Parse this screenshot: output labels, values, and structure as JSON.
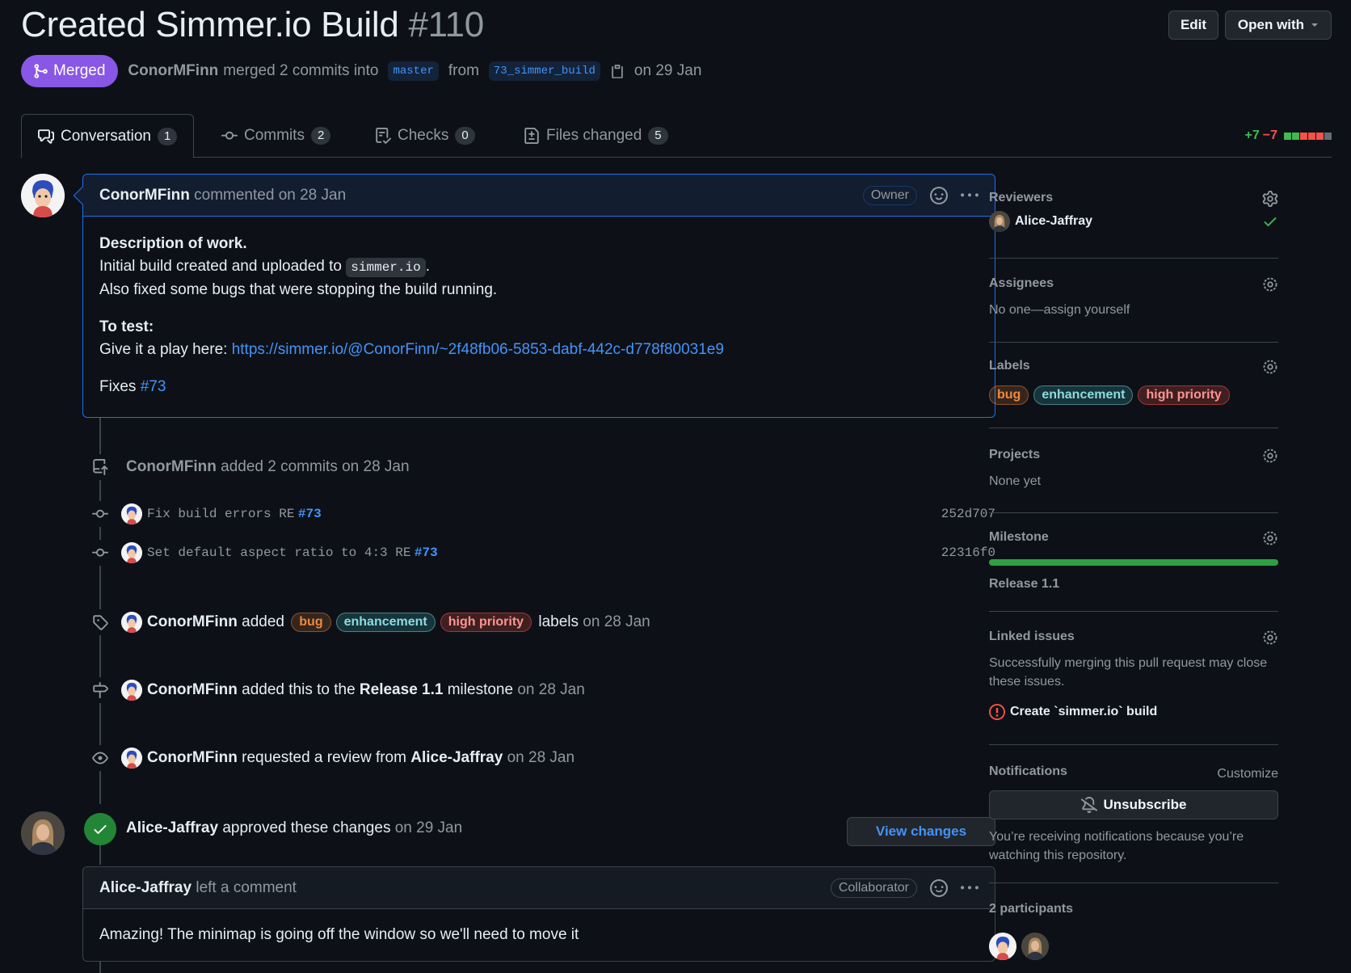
{
  "pr": {
    "title": "Created Simmer.io Build",
    "number": "#110"
  },
  "header": {
    "edit_label": "Edit",
    "open_with_label": "Open with"
  },
  "meta": {
    "status": "Merged",
    "author": "ConorMFinn",
    "action": "merged 2 commits into",
    "base_branch": "master",
    "from": "from",
    "head_branch": "73_simmer_build",
    "date": "on 29 Jan"
  },
  "tabs": [
    {
      "label": "Conversation",
      "count": "1",
      "icon": "comment-discussion-icon"
    },
    {
      "label": "Commits",
      "count": "2",
      "icon": "git-commit-icon"
    },
    {
      "label": "Checks",
      "count": "0",
      "icon": "checklist-icon"
    },
    {
      "label": "Files changed",
      "count": "5",
      "icon": "file-diff-icon"
    }
  ],
  "diffstat": {
    "additions": "+7",
    "deletions": "−7",
    "colors": [
      "#3fb950",
      "#3fb950",
      "#f85149",
      "#f85149",
      "#f85149",
      "#656c76"
    ]
  },
  "first_comment": {
    "author": "ConorMFinn",
    "action": "commented",
    "date": "on 28 Jan",
    "role": "Owner",
    "heading1": "Description of work.",
    "line1_pre": "Initial build created and uploaded to",
    "line1_code": "simmer.io",
    "line1_post": ".",
    "line2": "Also fixed some bugs that were stopping the build running.",
    "heading2": "To test:",
    "line3_pre": "Give it a play here:",
    "line3_link": "https://simmer.io/@ConorFinn/~2f48fb06-5853-dabf-442c-d778f80031e9",
    "fixes_pre": "Fixes",
    "fixes_link": "#73"
  },
  "timeline": {
    "commits_event": {
      "author": "ConorMFinn",
      "action": "added 2 commits",
      "date": "on 28 Jan"
    },
    "commits": [
      {
        "message": "Fix build errors RE",
        "ref": "#73",
        "sha": "252d707"
      },
      {
        "message": "Set default aspect ratio to 4:3 RE",
        "ref": "#73",
        "sha": "22316f0"
      }
    ],
    "labels_event": {
      "author": "ConorMFinn",
      "action": "added",
      "suffix": "labels",
      "date": "on 28 Jan"
    },
    "milestone_event": {
      "author": "ConorMFinn",
      "action": "added this to the",
      "milestone": "Release 1.1",
      "suffix": "milestone",
      "date": "on 28 Jan"
    },
    "review_request_event": {
      "author": "ConorMFinn",
      "action": "requested a review from",
      "reviewer": "Alice-Jaffray",
      "date": "on 28 Jan"
    },
    "approval_event": {
      "author": "Alice-Jaffray",
      "action": "approved these changes",
      "date": "on 29 Jan",
      "button": "View changes"
    }
  },
  "labels": [
    {
      "name": "bug",
      "color": "#f0883e"
    },
    {
      "name": "enhancement",
      "color": "#8ddbe0"
    },
    {
      "name": "high priority",
      "color": "#ff9492"
    }
  ],
  "second_comment": {
    "author": "Alice-Jaffray",
    "action": "left a comment",
    "role": "Collaborator",
    "body": "Amazing! The minimap is going off the window so we'll need to move it"
  },
  "sidebar": {
    "reviewers": {
      "title": "Reviewers",
      "name": "Alice-Jaffray"
    },
    "assignees": {
      "title": "Assignees",
      "text": "No one—assign yourself"
    },
    "labels": {
      "title": "Labels"
    },
    "projects": {
      "title": "Projects",
      "text": "None yet"
    },
    "milestone": {
      "title": "Milestone",
      "name": "Release 1.1",
      "progress": 1.0
    },
    "linked_issues": {
      "title": "Linked issues",
      "text": "Successfully merging this pull request may close these issues.",
      "issue": "Create `simmer.io` build"
    },
    "notifications": {
      "title": "Notifications",
      "customize": "Customize",
      "button": "Unsubscribe",
      "text": "You’re receiving notifications because you’re watching this repository."
    },
    "participants": {
      "title": "2 participants"
    }
  },
  "colors": {
    "accent": "#4493f8",
    "merged": "#8957e5",
    "success": "#238636",
    "danger": "#f85149"
  }
}
